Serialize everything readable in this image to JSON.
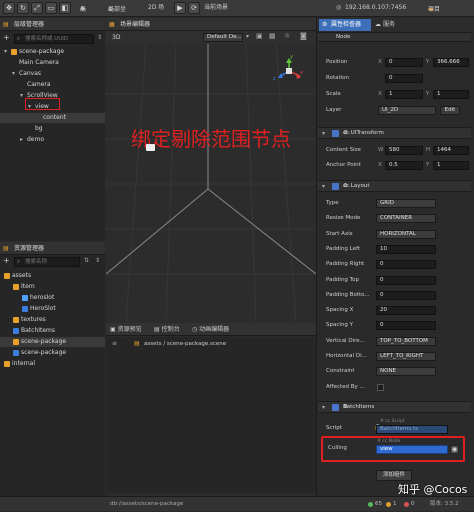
{
  "toolbar": {
    "tool_glyphs": [
      "✥",
      "↻",
      "⤢",
      "▭",
      "◧"
    ],
    "local": "局",
    "global_label": "局部坐",
    "mode_2d": "2D",
    "scene": "场",
    "play": "▶",
    "refresh": "⟳",
    "preview_label": "当前场景",
    "ip": "192.168.0.107:7456",
    "project_label": "项目"
  },
  "hierarchy": {
    "title": "层级管理器",
    "add": "+",
    "search_placeholder": "搜索名称或 UUID",
    "nodes": [
      {
        "label": "scene-package",
        "depth": 0,
        "arrow": "▾",
        "color": "#e6a02b"
      },
      {
        "label": "Main Camera",
        "depth": 1,
        "arrow": "",
        "color": ""
      },
      {
        "label": "Canvas",
        "depth": 1,
        "arrow": "▾",
        "color": ""
      },
      {
        "label": "Camera",
        "depth": 2,
        "arrow": "",
        "color": ""
      },
      {
        "label": "ScrollView",
        "depth": 2,
        "arrow": "▾",
        "color": ""
      },
      {
        "label": "view",
        "depth": 3,
        "arrow": "▾",
        "color": ""
      },
      {
        "label": "content",
        "depth": 4,
        "arrow": "",
        "color": ""
      },
      {
        "label": "bg",
        "depth": 3,
        "arrow": "",
        "color": ""
      },
      {
        "label": "demo",
        "depth": 2,
        "arrow": "▸",
        "color": ""
      }
    ]
  },
  "scene_editor": {
    "title": "场景编辑器",
    "mode": "3D",
    "camera_select": "Default De...",
    "annotation": "绑定剔除范围节点",
    "axis_y": "y",
    "axis_x": "x",
    "axis_z": "z"
  },
  "assets": {
    "title": "资源管理器",
    "add": "+",
    "search_placeholder": "搜索名称",
    "items": [
      {
        "label": "assets",
        "depth": 0,
        "icon": "folder"
      },
      {
        "label": "Item",
        "depth": 1,
        "icon": "folder"
      },
      {
        "label": "heroslot",
        "depth": 2,
        "icon": "prefab"
      },
      {
        "label": "HeroSlot",
        "depth": 2,
        "icon": "ts"
      },
      {
        "label": "textures",
        "depth": 1,
        "icon": "folder"
      },
      {
        "label": "BatchItems",
        "depth": 1,
        "icon": "ts"
      },
      {
        "label": "scene-package",
        "depth": 1,
        "icon": "scene"
      },
      {
        "label": "scene-package",
        "depth": 1,
        "icon": "ts"
      },
      {
        "label": "internal",
        "depth": 0,
        "icon": "folder"
      }
    ]
  },
  "bottom": {
    "tabs": [
      "资源预览",
      "控制台",
      "动画编辑器"
    ],
    "path": "assets / scene-package.scene",
    "status_path": "db://assets/scene-package"
  },
  "inspector": {
    "tabs": [
      "属性检查器",
      "服务"
    ],
    "header": "Node",
    "position": {
      "label": "Position",
      "x": "0",
      "y": "366.666"
    },
    "rotation": {
      "label": "Rotation",
      "value": "0"
    },
    "scale": {
      "label": "Scale",
      "x": "1",
      "y": "1"
    },
    "layer": {
      "label": "Layer",
      "value": "UI_2D",
      "edit": "Edit"
    },
    "uitransform": {
      "title": "cc.UITransform",
      "content_size": {
        "label": "Content Size",
        "w": "580",
        "h": "1464"
      },
      "anchor": {
        "label": "Anchor Point",
        "x": "0.5",
        "y": "1"
      }
    },
    "layout": {
      "title": "cc.Layout",
      "rows": [
        {
          "label": "Type",
          "value": "GRID",
          "kind": "select"
        },
        {
          "label": "Resize Mode",
          "value": "CONTAINER",
          "kind": "select"
        },
        {
          "label": "Start Axis",
          "value": "HORIZONTAL",
          "kind": "select"
        },
        {
          "label": "Padding Left",
          "value": "10",
          "kind": "field"
        },
        {
          "label": "Padding Right",
          "value": "0",
          "kind": "field"
        },
        {
          "label": "Padding Top",
          "value": "0",
          "kind": "field"
        },
        {
          "label": "Padding Botto...",
          "value": "0",
          "kind": "field"
        },
        {
          "label": "Spacing X",
          "value": "20",
          "kind": "field"
        },
        {
          "label": "Spacing Y",
          "value": "0",
          "kind": "field"
        },
        {
          "label": "Vertical Dire...",
          "value": "TOP_TO_BOTTOM",
          "kind": "select"
        },
        {
          "label": "Horizontal Di...",
          "value": "LEFT_TO_RIGHT",
          "kind": "select"
        },
        {
          "label": "Constraint",
          "value": "NONE",
          "kind": "select"
        },
        {
          "label": "Affected By ...",
          "value": "",
          "kind": "check"
        }
      ]
    },
    "batch": {
      "title": "BatchItems",
      "script_label": "Script",
      "script_tag": "# cc.Script",
      "script_value": "BatchItems.ts",
      "culling_label": "Culling",
      "culling_tag": "# cc.Node",
      "culling_value": "view",
      "add_component": "添加组件"
    }
  },
  "status": {
    "counts": [
      {
        "value": "65",
        "color": "#5cb85c"
      },
      {
        "value": "1",
        "color": "#e0a030"
      },
      {
        "value": "0",
        "color": "#d9534f"
      }
    ],
    "version": "版本: 3.5.2"
  },
  "watermark": "知乎 @Cocos"
}
